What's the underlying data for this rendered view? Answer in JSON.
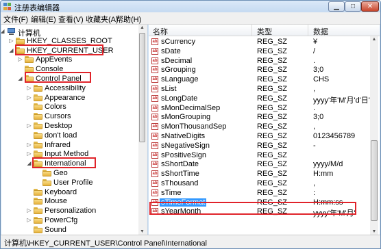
{
  "window": {
    "title": "注册表编辑器"
  },
  "menu": [
    "文件(F)",
    "编辑(E)",
    "查看(V)",
    "收藏夹(A)",
    "帮助(H)"
  ],
  "tree": {
    "root": "计算机",
    "items": [
      {
        "label": "HKEY_CLASSES_ROOT",
        "level": 1,
        "expand": "closed"
      },
      {
        "label": "HKEY_CURRENT_USER",
        "level": 1,
        "expand": "open"
      },
      {
        "label": "AppEvents",
        "level": 2,
        "expand": "closed"
      },
      {
        "label": "Console",
        "level": 2,
        "expand": "none"
      },
      {
        "label": "Control Panel",
        "level": 2,
        "expand": "open"
      },
      {
        "label": "Accessibility",
        "level": 3,
        "expand": "closed"
      },
      {
        "label": "Appearance",
        "level": 3,
        "expand": "closed"
      },
      {
        "label": "Colors",
        "level": 3,
        "expand": "none"
      },
      {
        "label": "Cursors",
        "level": 3,
        "expand": "none"
      },
      {
        "label": "Desktop",
        "level": 3,
        "expand": "closed"
      },
      {
        "label": "don't load",
        "level": 3,
        "expand": "none"
      },
      {
        "label": "Infrared",
        "level": 3,
        "expand": "closed"
      },
      {
        "label": "Input Method",
        "level": 3,
        "expand": "closed"
      },
      {
        "label": "International",
        "level": 3,
        "expand": "open"
      },
      {
        "label": "Geo",
        "level": 4,
        "expand": "none"
      },
      {
        "label": "User Profile",
        "level": 4,
        "expand": "none"
      },
      {
        "label": "Keyboard",
        "level": 3,
        "expand": "none"
      },
      {
        "label": "Mouse",
        "level": 3,
        "expand": "none"
      },
      {
        "label": "Personalization",
        "level": 3,
        "expand": "closed"
      },
      {
        "label": "PowerCfg",
        "level": 3,
        "expand": "closed"
      },
      {
        "label": "Sound",
        "level": 3,
        "expand": "none"
      }
    ]
  },
  "list": {
    "headers": {
      "name": "名称",
      "type": "类型",
      "data": "数据"
    },
    "rows": [
      {
        "name": "sCurrency",
        "type": "REG_SZ",
        "data": "¥"
      },
      {
        "name": "sDate",
        "type": "REG_SZ",
        "data": "/"
      },
      {
        "name": "sDecimal",
        "type": "REG_SZ",
        "data": "."
      },
      {
        "name": "sGrouping",
        "type": "REG_SZ",
        "data": "3;0"
      },
      {
        "name": "sLanguage",
        "type": "REG_SZ",
        "data": "CHS"
      },
      {
        "name": "sList",
        "type": "REG_SZ",
        "data": ","
      },
      {
        "name": "sLongDate",
        "type": "REG_SZ",
        "data": "yyyy'年'M'月'd'日'"
      },
      {
        "name": "sMonDecimalSep",
        "type": "REG_SZ",
        "data": "."
      },
      {
        "name": "sMonGrouping",
        "type": "REG_SZ",
        "data": "3;0"
      },
      {
        "name": "sMonThousandSep",
        "type": "REG_SZ",
        "data": ","
      },
      {
        "name": "sNativeDigits",
        "type": "REG_SZ",
        "data": "0123456789"
      },
      {
        "name": "sNegativeSign",
        "type": "REG_SZ",
        "data": "-"
      },
      {
        "name": "sPositiveSign",
        "type": "REG_SZ",
        "data": ""
      },
      {
        "name": "sShortDate",
        "type": "REG_SZ",
        "data": "yyyy/M/d"
      },
      {
        "name": "sShortTime",
        "type": "REG_SZ",
        "data": "H:mm"
      },
      {
        "name": "sThousand",
        "type": "REG_SZ",
        "data": ","
      },
      {
        "name": "sTime",
        "type": "REG_SZ",
        "data": ":"
      },
      {
        "name": "sTimeFormat",
        "type": "REG_SZ",
        "data": "H:mm:ss",
        "selected": true
      },
      {
        "name": "sYearMonth",
        "type": "REG_SZ",
        "data": "yyyy'年'M'月'"
      }
    ]
  },
  "status": "计算机\\HKEY_CURRENT_USER\\Control Panel\\International",
  "colors": {
    "highlight_box": "#e0232a",
    "selection": "#3399ff"
  }
}
